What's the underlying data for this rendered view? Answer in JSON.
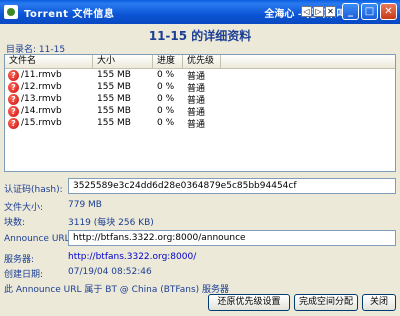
{
  "window": {
    "title": "Torrent 文件信息",
    "marquee": "全海心 – 把耳朵叫醒",
    "tiny_buttons": [
      "◁",
      "▷",
      "✕"
    ],
    "controls": {
      "minimize": "_",
      "maximize": "□",
      "close": "✕"
    }
  },
  "heading": "11-15 的详细资料",
  "directory": {
    "label": "目录名:",
    "value": "11-15"
  },
  "filelist": {
    "columns": [
      "文件名",
      "大小",
      "进度",
      "优先级"
    ],
    "rows": [
      {
        "name": "/11.rmvb",
        "size": "155 MB",
        "progress": "0 %",
        "priority": "普通"
      },
      {
        "name": "/12.rmvb",
        "size": "155 MB",
        "progress": "0 %",
        "priority": "普通"
      },
      {
        "name": "/13.rmvb",
        "size": "155 MB",
        "progress": "0 %",
        "priority": "普通"
      },
      {
        "name": "/14.rmvb",
        "size": "155 MB",
        "progress": "0 %",
        "priority": "普通"
      },
      {
        "name": "/15.rmvb",
        "size": "155 MB",
        "progress": "0 %",
        "priority": "普通"
      }
    ]
  },
  "hash": {
    "label": "认证码(hash):",
    "value": "3525589e3c24dd6d28e0364879e5c85bb94454cf"
  },
  "file_size": {
    "label": "文件大小:",
    "value": "779 MB"
  },
  "blocks": {
    "label": "块数:",
    "value": "3119 (每块 256 KB)"
  },
  "announce": {
    "label": "Announce URL:",
    "value": "http://btfans.3322.org:8000/announce"
  },
  "server": {
    "label": "服务器:",
    "value": "http://btfans.3322.org:8000/"
  },
  "created": {
    "label": "创建日期:",
    "value": "07/19/04 08:52:46"
  },
  "note": "此 Announce URL 属于 BT @ China (BTFans) 服务器",
  "buttons": {
    "reset": "还原优先级设置",
    "finish": "完成空间分配",
    "close": "关闭"
  }
}
